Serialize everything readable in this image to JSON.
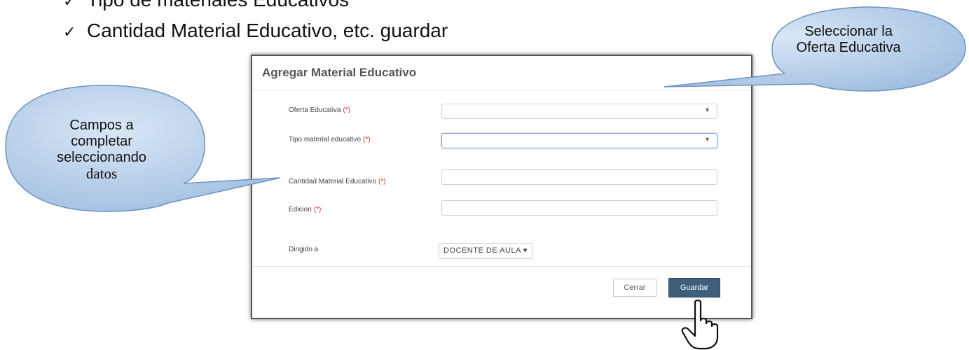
{
  "bullets": [
    {
      "text": "Tipo de materiales Educativos"
    },
    {
      "text": "Cantidad Material Educativo, etc. guardar"
    }
  ],
  "modal": {
    "title": "Agregar Material Educativo",
    "fields": {
      "oferta": {
        "label": "Oferta Educativa",
        "required": "(*)",
        "value": ""
      },
      "tipo": {
        "label": "Tipo material educativo",
        "required": "(*)",
        "value": ""
      },
      "cantidad": {
        "label": "Cantidad Material Educativo",
        "required": "(*)",
        "value": ""
      },
      "edicion": {
        "label": "Edicion",
        "required": "(*)",
        "value": ""
      },
      "dirigido": {
        "label": "Dirigido a",
        "value": "DOCENTE DE AULA ▾"
      }
    },
    "buttons": {
      "cerrar": "Cerrar",
      "guardar": "Guardar"
    }
  },
  "callouts": {
    "oferta_line1": "Seleccionar la",
    "oferta_line2": "Oferta Educativa",
    "campos_line1": "Campos a",
    "campos_line2": "completar",
    "campos_line3": "seleccionando",
    "campos_line4": "datos"
  },
  "colors": {
    "primary_button": "#3d5f7c",
    "required": "#c0392b",
    "callout_fill": "#b9d1ea"
  },
  "icons": {
    "check": "check-icon",
    "caret": "caret-down-icon",
    "pointer": "hand-pointer-icon"
  }
}
